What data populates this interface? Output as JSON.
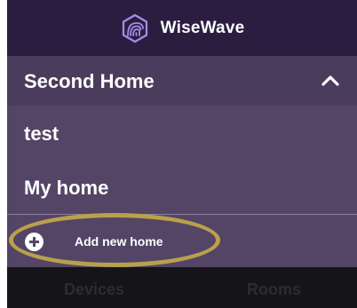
{
  "header": {
    "app_name": "WiseWave",
    "logo_icon": "wisewave-logo-icon"
  },
  "home_menu": {
    "current_home": "Second Home",
    "expanded": true,
    "homes": [
      "test",
      "My home"
    ],
    "add_home_label": "Add new home",
    "add_icon": "plus-circle-icon"
  },
  "bottom_nav": {
    "tabs": [
      "Devices",
      "Rooms"
    ]
  },
  "colors": {
    "header_bg": "#2a1d40",
    "menu_bg": "#544566",
    "highlight": "#b9a14b",
    "logo": "#a58ee8"
  }
}
